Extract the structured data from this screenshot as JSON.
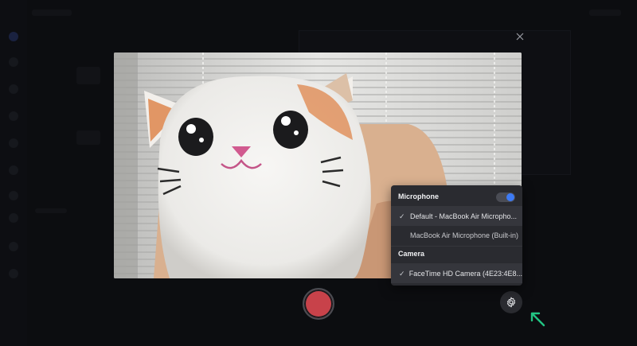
{
  "dialog": {
    "close_icon": "close-icon",
    "preview_content": "camera-feed-plush-cat"
  },
  "controls": {
    "record_icon": "record-icon",
    "record_color": "#c8424a",
    "settings_icon": "gear-icon",
    "annotation_icon": "arrow-up-left-icon",
    "annotation_color": "#22c483"
  },
  "settings_menu": {
    "microphone_header": "Microphone",
    "microphone_enabled": true,
    "microphone_options": [
      {
        "label": "Default - MacBook Air Micropho...",
        "selected": true
      },
      {
        "label": "MacBook Air Microphone (Built-in)",
        "selected": false
      }
    ],
    "camera_header": "Camera",
    "camera_options": [
      {
        "label": "FaceTime HD Camera (4E23:4E8...",
        "selected": true
      }
    ],
    "check_glyph": "✓",
    "accent_color": "#3d7bf5"
  }
}
